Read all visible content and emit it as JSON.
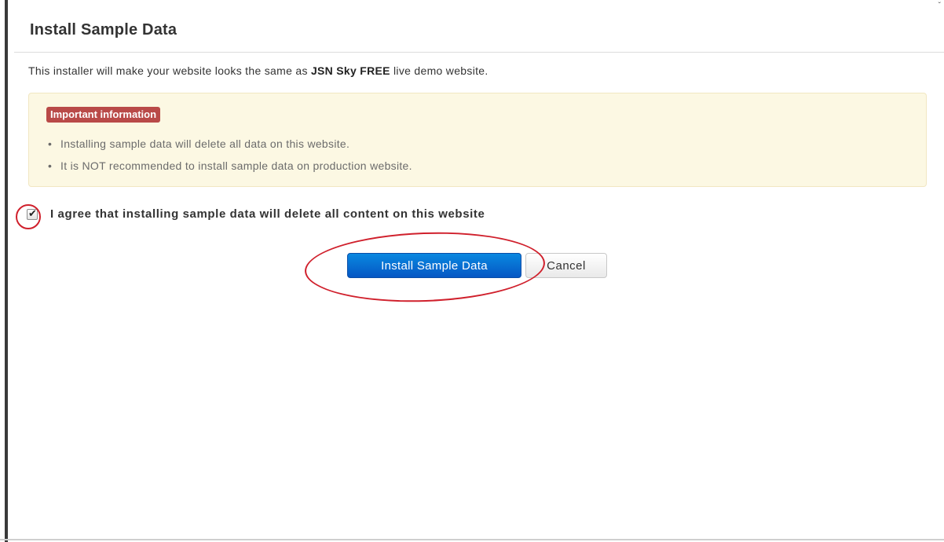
{
  "modal": {
    "title": "Install Sample Data",
    "intro_prefix": "This installer will make your website looks the same as ",
    "intro_bold": "JSN Sky FREE",
    "intro_suffix": " live demo website."
  },
  "alert": {
    "label": "Important information",
    "bullet_char": "•",
    "items": [
      "Installing sample data will delete all data on this website.",
      "It is NOT recommended to install sample data on production website."
    ],
    "background_color": "#fcf8e3",
    "label_color": "#b94a48"
  },
  "agreement": {
    "checked": true,
    "check_glyph": "✔",
    "label": "I agree that installing sample data will delete all content on this website"
  },
  "buttons": {
    "install_label": "Install Sample Data",
    "cancel_label": "Cancel",
    "primary_color": "#0a6fd6"
  },
  "annotation": {
    "highlight_color": "#d0202c"
  }
}
